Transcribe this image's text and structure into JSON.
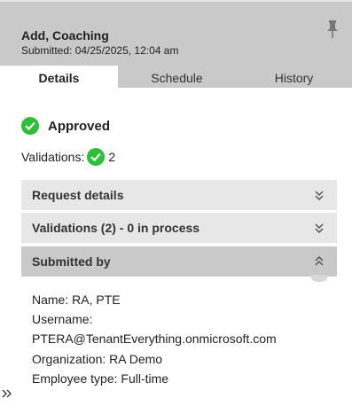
{
  "header": {
    "title": "Add, Coaching",
    "submitted": "Submitted: 04/25/2025, 12:04 am",
    "pin_icon": "pin-icon"
  },
  "tabs": [
    {
      "label": "Details",
      "active": true
    },
    {
      "label": "Schedule",
      "active": false
    },
    {
      "label": "History",
      "active": false
    }
  ],
  "status": {
    "label": "Approved",
    "icon": "check-circle-icon",
    "color": "#2ebf38"
  },
  "validations": {
    "label": "Validations:",
    "count": "2"
  },
  "sections": [
    {
      "label": "Request details",
      "expanded": false
    },
    {
      "label": "Validations (2) - 0 in process",
      "expanded": false
    },
    {
      "label": "Submitted by",
      "expanded": true
    }
  ],
  "submitted_by": {
    "name": "Name: RA, PTE",
    "username_label": "Username:",
    "username": "PTERA@TenantEverything.onmicrosoft.com",
    "organization": "Organization: RA Demo",
    "employee_type": "Employee type: Full-time"
  },
  "colors": {
    "header_bg": "#c9c9c9",
    "section_bg": "#e7e7e7",
    "success": "#2ebf38"
  }
}
